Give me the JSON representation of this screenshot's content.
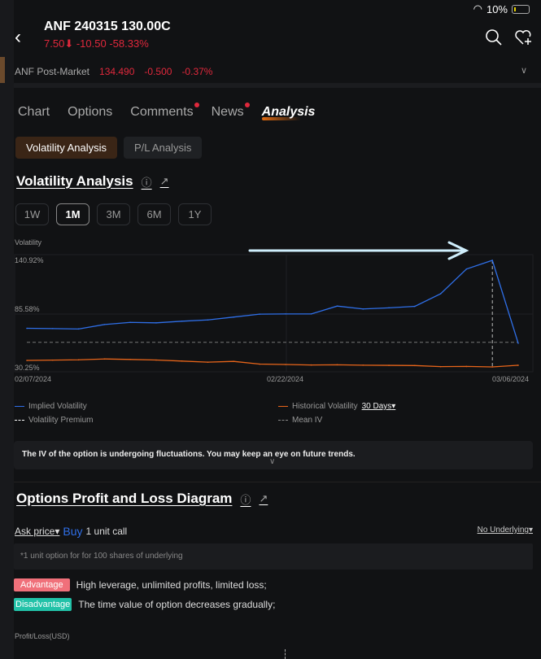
{
  "status": {
    "battery": "10%"
  },
  "header": {
    "title": "ANF 240315 130.00C",
    "price": "7.50",
    "change": "-10.50",
    "change_pct": "-58.33%"
  },
  "post_market": {
    "label": "ANF Post-Market",
    "price": "134.490",
    "change": "-0.500",
    "change_pct": "-0.37%"
  },
  "tabs": [
    {
      "label": "Chart"
    },
    {
      "label": "Options"
    },
    {
      "label": "Comments"
    },
    {
      "label": "News"
    },
    {
      "label": "Analysis"
    }
  ],
  "subtabs": [
    {
      "label": "Volatility Analysis"
    },
    {
      "label": "P/L Analysis"
    }
  ],
  "volatility": {
    "title": "Volatility Analysis",
    "ranges": [
      "1W",
      "1M",
      "3M",
      "6M",
      "1Y"
    ],
    "selected_range": "1M",
    "note": "The IV of the option is undergoing fluctuations. You may keep an eye on future trends.",
    "legend": {
      "iv": "Implied Volatility",
      "hv": "Historical Volatility",
      "hv_period": "30 Days",
      "premium": "Volatility Premium",
      "mean": "Mean IV"
    }
  },
  "chart_data": {
    "type": "line",
    "ylabel": "Volatility",
    "ytick_labels": [
      "140.92%",
      "85.58%",
      "30.25%"
    ],
    "ylim": [
      30.25,
      140.92
    ],
    "xtick_labels": [
      "02/07/2024",
      "02/22/2024",
      "03/06/2024"
    ],
    "x": [
      "02/07/2024",
      "02/08/2024",
      "02/09/2024",
      "02/12/2024",
      "02/13/2024",
      "02/14/2024",
      "02/15/2024",
      "02/16/2024",
      "02/20/2024",
      "02/21/2024",
      "02/22/2024",
      "02/23/2024",
      "02/26/2024",
      "02/27/2024",
      "02/28/2024",
      "02/29/2024",
      "03/01/2024",
      "03/04/2024",
      "03/05/2024",
      "03/06/2024"
    ],
    "series": [
      {
        "name": "Implied Volatility",
        "color": "#2f6fe8",
        "values": [
          70.9,
          70.6,
          70.2,
          74.8,
          77.0,
          76.5,
          78.2,
          79.5,
          82.5,
          85.5,
          85.7,
          85.7,
          93.8,
          90.8,
          92.0,
          93.5,
          106.5,
          132.0,
          140.92,
          55.5
        ]
      },
      {
        "name": "Historical Volatility",
        "color": "#e8651a",
        "values": [
          37.8,
          38.1,
          38.4,
          39.3,
          38.8,
          38.2,
          37.1,
          36.0,
          36.8,
          34.0,
          33.6,
          33.1,
          33.3,
          32.9,
          32.7,
          32.5,
          31.4,
          31.6,
          31.1,
          32.8
        ]
      }
    ],
    "mean_iv": 56.5,
    "highlight_date": "03/05/2024",
    "grid": true
  },
  "pl": {
    "title": "Options Profit and Loss Diagram",
    "price_type": "Ask price",
    "side": "Buy",
    "desc": "1 unit call",
    "underlying": "No Underlying",
    "hint": "*1 unit option for for 100 shares of underlying",
    "advantage_label": "Advantage",
    "advantage": "High leverage, unlimited profits, limited loss;",
    "disadvantage_label": "Disadvantage",
    "disadvantage": "The time value of option decreases gradually;",
    "ylabel": "Profit/Loss(USD)"
  },
  "colors": {
    "accent": "#e06a10",
    "red": "#e0283c",
    "advantage": "#f0707a",
    "disadvantage": "#22c2a8",
    "buy": "#2f6fe8"
  }
}
